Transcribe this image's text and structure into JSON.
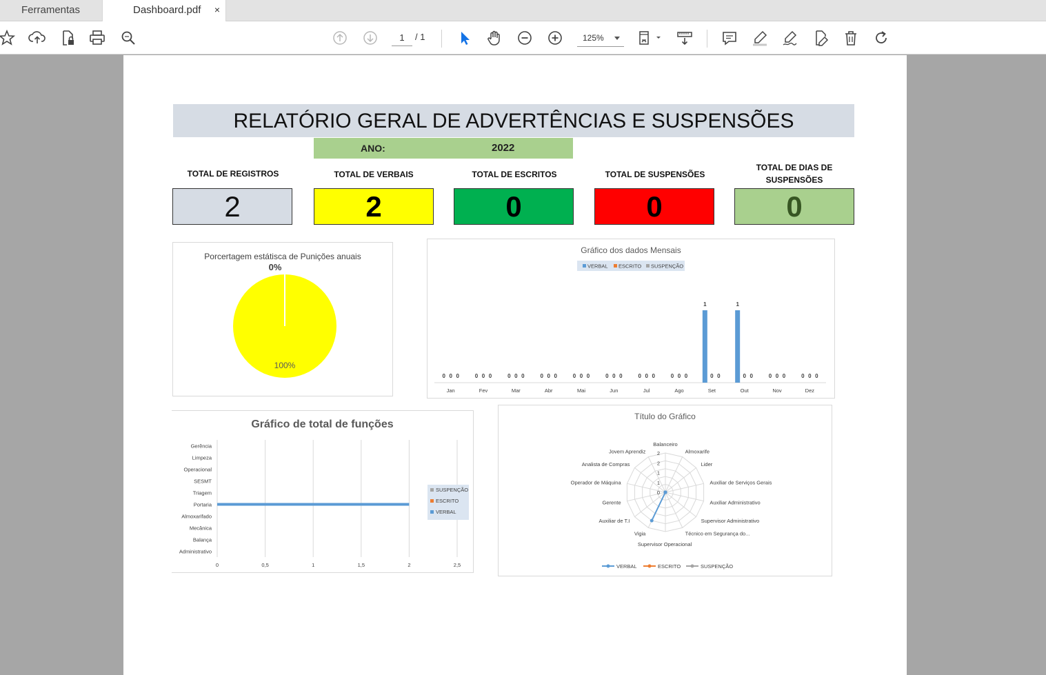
{
  "tabs": {
    "tools_label": "Ferramentas",
    "doc_label": "Dashboard.pdf",
    "close_glyph": "×"
  },
  "toolbar": {
    "page_current": "1",
    "page_total": "/ 1",
    "zoom": "125%",
    "accent": "#1473e6"
  },
  "report": {
    "title": "RELATÓRIO GERAL DE ADVERTÊNCIAS E SUSPENSÕES",
    "year_label": "ANO:",
    "year_value": "2022",
    "kpis": [
      {
        "label": "TOTAL DE REGISTROS",
        "value": "2",
        "bg": "#d6dce4",
        "color": "#111111"
      },
      {
        "label": "TOTAL DE VERBAIS",
        "value": "2",
        "bg": "#ffff00",
        "color": "#000000"
      },
      {
        "label": "TOTAL DE ESCRITOS",
        "value": "0",
        "bg": "#00b050",
        "color": "#000000"
      },
      {
        "label": "TOTAL DE SUSPENSÕES",
        "value": "0",
        "bg": "#ff0000",
        "color": "#000000"
      },
      {
        "label": "TOTAL DE DIAS DE SUSPENSÕES",
        "value": "0",
        "bg": "#a9d08e",
        "color": "#375623"
      }
    ]
  },
  "chart_data": [
    {
      "type": "pie",
      "title": "Porcertagem estátisca de Punições anuais",
      "slices": [
        {
          "label": "0%",
          "value": 0,
          "color": "#ffffff"
        },
        {
          "label": "100%",
          "value": 100,
          "color": "#ffff00"
        }
      ]
    },
    {
      "type": "bar",
      "title": "Gráfico dos dados Mensais",
      "legend_position": "top",
      "categories": [
        "Jan",
        "Fev",
        "Mar",
        "Abr",
        "Mai",
        "Jun",
        "Jul",
        "Ago",
        "Set",
        "Out",
        "Nov",
        "Dez"
      ],
      "series": [
        {
          "name": "VERBAL",
          "color": "#5b9bd5",
          "values": [
            0,
            0,
            0,
            0,
            0,
            0,
            0,
            0,
            1,
            1,
            0,
            0
          ]
        },
        {
          "name": "ESCRITO",
          "color": "#ed7d31",
          "values": [
            0,
            0,
            0,
            0,
            0,
            0,
            0,
            0,
            0,
            0,
            0,
            0
          ]
        },
        {
          "name": "SUSPENÇÃO",
          "color": "#a5a5a5",
          "values": [
            0,
            0,
            0,
            0,
            0,
            0,
            0,
            0,
            0,
            0,
            0,
            0
          ]
        }
      ],
      "data_labels": [
        [
          "0",
          "0",
          "0"
        ],
        [
          "0",
          "0",
          "0"
        ],
        [
          "0",
          "0",
          "0"
        ],
        [
          "0",
          "0",
          "0"
        ],
        [
          "0",
          "0",
          "0"
        ],
        [
          "0",
          "0",
          "0"
        ],
        [
          "0",
          "0",
          "0"
        ],
        [
          "0",
          "0",
          "0"
        ],
        [
          "1",
          "0",
          "0"
        ],
        [
          "1",
          "0",
          "0"
        ],
        [
          "0",
          "0",
          "0"
        ],
        [
          "0",
          "0",
          "0"
        ]
      ],
      "data_labels_printed": [
        "000",
        "000",
        "000",
        "000",
        "000",
        "000",
        "000",
        "000",
        "1 00",
        "1 00",
        "000",
        "000"
      ],
      "ylim": [
        0,
        1.2
      ]
    },
    {
      "type": "bar",
      "orientation": "horizontal",
      "title": "Gráfico de total de funções",
      "legend_position": "right",
      "categories": [
        "Administrativo",
        "Balança",
        "Mecânica",
        "Almoxarifado",
        "Portaria",
        "Triagem",
        "SESMT",
        "Operacional",
        "Limpeza",
        "Gerência"
      ],
      "x_ticks": [
        "0",
        "0,5",
        "1",
        "1,5",
        "2",
        "2,5"
      ],
      "xlim": [
        0,
        2.5
      ],
      "series": [
        {
          "name": "VERBAL",
          "color": "#5b9bd5",
          "values": [
            0,
            0,
            0,
            0,
            2,
            0,
            0,
            0,
            0,
            0
          ]
        },
        {
          "name": "ESCRITO",
          "color": "#ed7d31",
          "values": [
            0,
            0,
            0,
            0,
            0,
            0,
            0,
            0,
            0,
            0
          ]
        },
        {
          "name": "SUSPENÇÃO",
          "color": "#a5a5a5",
          "values": [
            0,
            0,
            0,
            0,
            0,
            0,
            0,
            0,
            0,
            0
          ]
        }
      ]
    },
    {
      "type": "radar",
      "title": "Título do Gráfico",
      "legend_position": "bottom",
      "categories": [
        "Balanceiro",
        "Almoxarife",
        "Lider",
        "Auxiliar de Serviços Gerais",
        "Auxiliar Administrativo",
        "Supervisor Administrativo",
        "Técnico em Segurança do...",
        "Supervisor Operacional",
        "Vigia",
        "Auxiliar de T.I",
        "Gerente",
        "Operador de Máquina",
        "Analista de Compras",
        "Jovem Aprendiz"
      ],
      "r_ticks": [
        "0",
        "1",
        "1",
        "2",
        "2"
      ],
      "rlim": [
        0,
        2.5
      ],
      "series": [
        {
          "name": "VERBAL",
          "color": "#5b9bd5",
          "values": [
            0,
            0,
            0,
            0,
            0,
            0,
            0,
            0,
            2,
            0,
            0,
            0,
            0,
            0
          ]
        },
        {
          "name": "ESCRITO",
          "color": "#ed7d31",
          "values": [
            0,
            0,
            0,
            0,
            0,
            0,
            0,
            0,
            0,
            0,
            0,
            0,
            0,
            0
          ]
        },
        {
          "name": "SUSPENÇÃO",
          "color": "#a5a5a5",
          "values": [
            0,
            0,
            0,
            0,
            0,
            0,
            0,
            0,
            0,
            0,
            0,
            0,
            0,
            0
          ]
        }
      ]
    }
  ]
}
